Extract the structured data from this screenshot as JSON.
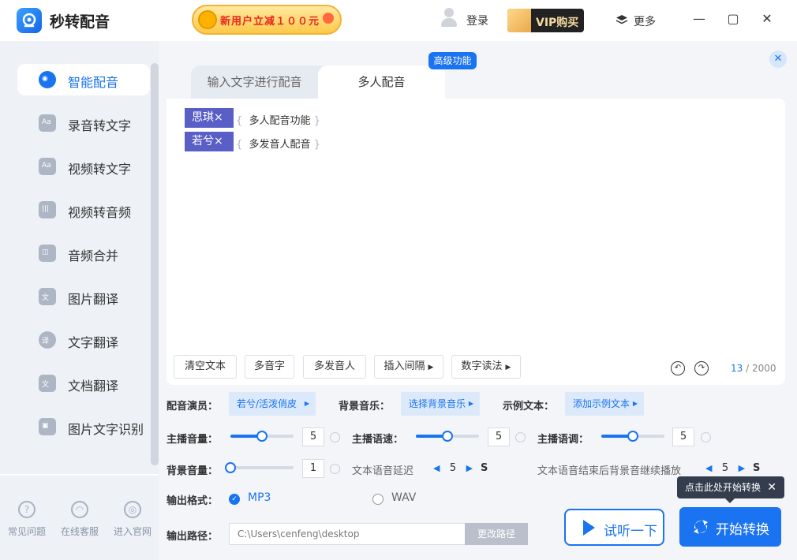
{
  "app": {
    "name": "秒转配音",
    "promo": "新用户立减１００元",
    "login": "登录",
    "vip": "VIP购买",
    "more": "更多"
  },
  "sidebar": {
    "items": [
      {
        "label": "智能配音",
        "icon": "smart-dubbing-icon"
      },
      {
        "label": "录音转文字",
        "icon": "audio-to-text-icon"
      },
      {
        "label": "视频转文字",
        "icon": "video-to-text-icon"
      },
      {
        "label": "视频转音频",
        "icon": "video-to-audio-icon"
      },
      {
        "label": "音频合并",
        "icon": "audio-merge-icon"
      },
      {
        "label": "图片翻译",
        "icon": "image-translate-icon"
      },
      {
        "label": "文字翻译",
        "icon": "text-translate-icon"
      },
      {
        "label": "文档翻译",
        "icon": "doc-translate-icon"
      },
      {
        "label": "图片文字识别",
        "icon": "ocr-icon"
      }
    ],
    "footer": [
      "常见问题",
      "在线客服",
      "进入官网"
    ]
  },
  "tabs": {
    "tab1": "输入文字进行配音",
    "tab2": "多人配音",
    "badge": "高级功能"
  },
  "editor": {
    "lines": [
      {
        "speaker": "思琪×",
        "text": "多人配音功能"
      },
      {
        "speaker": "若兮×",
        "text": "多发音人配音"
      }
    ],
    "toolbar": [
      "清空文本",
      "多音字",
      "多发音人",
      "插入间隔",
      "数字读法"
    ],
    "count_current": "13",
    "count_max": "/ 2000"
  },
  "settings": {
    "voice_label": "配音演员：",
    "voice_value": "若兮/活泼俏皮",
    "bgm_label": "背景音乐：",
    "bgm_value": "选择背景音乐",
    "sample_label": "示例文本：",
    "sample_value": "添加示例文本",
    "volume_label": "主播音量：",
    "volume_value": "5",
    "volume_level": 0.5,
    "speed_label": "主播语速：",
    "speed_value": "5",
    "speed_level": 0.5,
    "pitch_label": "主播语调：",
    "pitch_value": "5",
    "pitch_level": 0.5,
    "bg_volume_label": "背景音量：",
    "bg_volume_value": "1",
    "bg_volume_level": 0.0,
    "delay_label": "文本语音延迟",
    "delay_value": "5",
    "delay_unit": "S",
    "continue_label": "文本语音结束后背景音继续播放",
    "continue_value": "5",
    "continue_unit": "S",
    "format_label": "输出格式：",
    "format_mp3": "MP3",
    "format_wav": "WAV",
    "path_label": "输出路径：",
    "path_value": "C:\\Users\\cenfeng\\desktop",
    "path_button": "更改路径"
  },
  "actions": {
    "listen": "试听一下",
    "start": "开始转换",
    "tip": "点击此处开始转换"
  },
  "colors": {
    "accent": "#1a73f0",
    "speaker_tag": "#5a5fc7"
  }
}
